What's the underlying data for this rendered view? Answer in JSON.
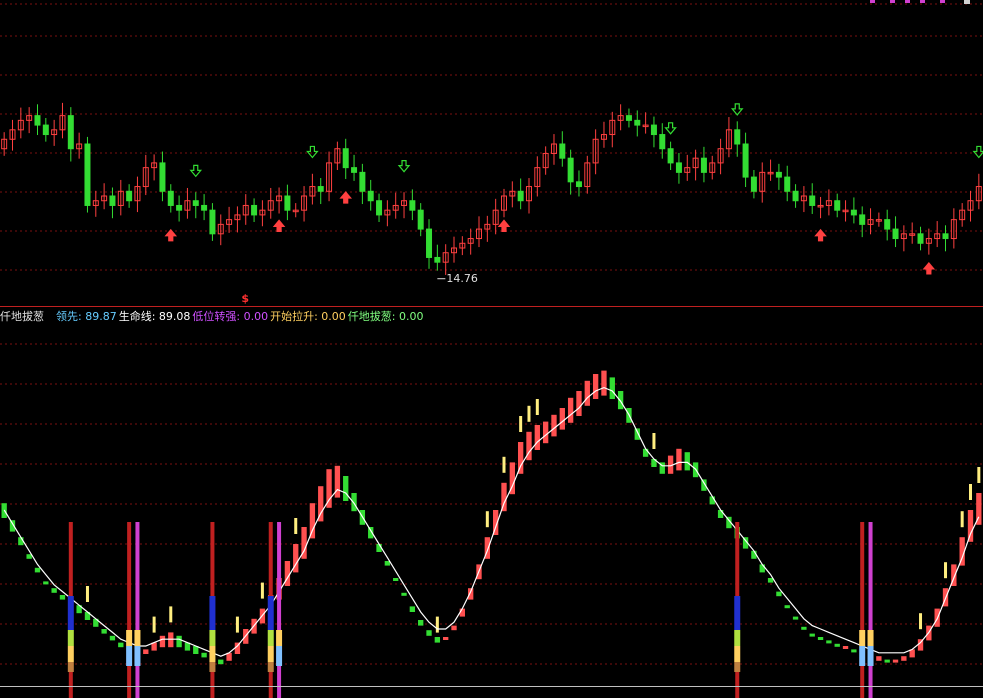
{
  "chart_data": [
    {
      "type": "candlestick",
      "title": "",
      "grid": true,
      "annotations": {
        "low_label": "14.76",
        "signal_mark": "$",
        "up_arrow_indices": [
          20,
          33,
          41,
          60,
          98,
          111,
          125,
          154
        ],
        "down_arrow_indices": [
          23,
          37,
          48,
          80,
          88,
          117,
          120,
          130
        ],
        "colors": {
          "up": "#ff4040",
          "down": "#33dd33",
          "up_arrow": "#ff4040",
          "down_arrow": "#33dd33"
        }
      },
      "close": [
        17.4,
        17.6,
        17.8,
        17.9,
        17.7,
        17.5,
        17.6,
        17.9,
        17.2,
        17.3,
        16.0,
        16.1,
        16.2,
        16.0,
        16.3,
        16.1,
        16.4,
        16.8,
        16.9,
        16.3,
        16.0,
        15.9,
        16.1,
        16.0,
        15.9,
        15.4,
        15.6,
        15.7,
        15.8,
        16.0,
        15.8,
        15.9,
        16.1,
        16.2,
        15.9,
        15.9,
        16.2,
        16.4,
        16.3,
        16.9,
        17.2,
        16.8,
        16.7,
        16.3,
        16.1,
        15.8,
        15.9,
        16.0,
        16.1,
        15.9,
        15.5,
        14.9,
        14.8,
        15.0,
        15.1,
        15.2,
        15.3,
        15.5,
        15.6,
        15.9,
        16.2,
        16.3,
        16.1,
        16.4,
        16.8,
        17.1,
        17.3,
        17.0,
        16.5,
        16.4,
        16.9,
        17.4,
        17.5,
        17.8,
        17.9,
        17.8,
        17.7,
        17.7,
        17.5,
        17.2,
        16.9,
        16.7,
        16.8,
        17.0,
        16.7,
        16.9,
        17.2,
        17.6,
        17.3,
        16.6,
        16.3,
        16.7,
        16.7,
        16.6,
        16.3,
        16.1,
        16.2,
        16.0,
        16.0,
        16.1,
        15.9,
        15.9,
        15.8,
        15.6,
        15.7,
        15.7,
        15.5,
        15.3,
        15.4,
        15.4,
        15.2,
        15.3,
        15.4,
        15.3,
        15.7,
        15.9,
        16.1,
        16.4
      ],
      "ylim": [
        14.0,
        19.5
      ]
    },
    {
      "type": "bar",
      "title": "",
      "legend": [
        {
          "label": "仟地拔葱",
          "value": "",
          "color": "#e0e0e0"
        },
        {
          "label": "领先:",
          "value": "89.87",
          "color": "#66ccff"
        },
        {
          "label": "生命线:",
          "value": "89.08",
          "color": "#ffffff"
        },
        {
          "label": "低位转强:",
          "value": "0.00",
          "color": "#d050ff"
        },
        {
          "label": "开始拉升:",
          "value": "0.00",
          "color": "#ffd060"
        },
        {
          "label": "仟地拔葱:",
          "value": "0.00",
          "color": "#80ff80"
        }
      ],
      "lead": [
        52,
        47,
        42,
        37,
        33,
        29,
        27,
        25,
        24,
        22,
        20,
        18,
        15,
        13,
        11,
        10,
        9,
        9,
        11,
        13,
        14,
        13,
        11,
        10,
        8,
        7,
        6,
        8,
        11,
        15,
        18,
        21,
        25,
        30,
        35,
        40,
        45,
        52,
        57,
        62,
        63,
        60,
        55,
        50,
        45,
        40,
        35,
        30,
        25,
        20,
        16,
        13,
        11,
        12,
        16,
        21,
        27,
        34,
        42,
        50,
        58,
        64,
        70,
        73,
        75,
        76,
        78,
        80,
        83,
        85,
        88,
        90,
        91,
        89,
        85,
        80,
        74,
        68,
        65,
        64,
        66,
        68,
        67,
        64,
        59,
        54,
        50,
        48,
        45,
        42,
        38,
        34,
        30,
        26,
        22,
        18,
        15,
        13,
        12,
        11,
        10,
        10,
        9,
        8,
        7,
        7,
        6,
        6,
        7,
        9,
        12,
        16,
        21,
        27,
        34,
        42,
        50,
        55
      ],
      "life": [
        50,
        46,
        42,
        38,
        34,
        31,
        28,
        26,
        24,
        22,
        20,
        18,
        16,
        14,
        12,
        11,
        10,
        10,
        11,
        12,
        12,
        12,
        11,
        10,
        9,
        8,
        7,
        8,
        10,
        13,
        16,
        19,
        22,
        26,
        30,
        34,
        38,
        44,
        49,
        53,
        56,
        55,
        52,
        48,
        44,
        40,
        36,
        32,
        28,
        24,
        20,
        17,
        15,
        15,
        17,
        21,
        26,
        32,
        38,
        45,
        52,
        57,
        63,
        67,
        70,
        72,
        74,
        76,
        78,
        80,
        83,
        85,
        86,
        85,
        82,
        78,
        73,
        68,
        65,
        63,
        63,
        64,
        64,
        62,
        58,
        54,
        50,
        47,
        44,
        41,
        38,
        34,
        31,
        27,
        24,
        21,
        18,
        16,
        15,
        14,
        13,
        12,
        11,
        10,
        9,
        8,
        8,
        8,
        8,
        9,
        11,
        14,
        18,
        24,
        30,
        36,
        43,
        48
      ],
      "colors": {
        "rising": "#ff5050",
        "falling": "#33dd33",
        "life_line": "#ffffff"
      },
      "yellow_ticks": [
        10,
        18,
        20,
        28,
        31,
        35,
        52,
        58,
        60,
        62,
        63,
        64,
        78,
        110,
        113,
        115,
        116,
        117
      ],
      "signals": [
        8,
        15,
        16,
        25,
        32,
        33,
        88,
        103,
        104
      ]
    }
  ]
}
